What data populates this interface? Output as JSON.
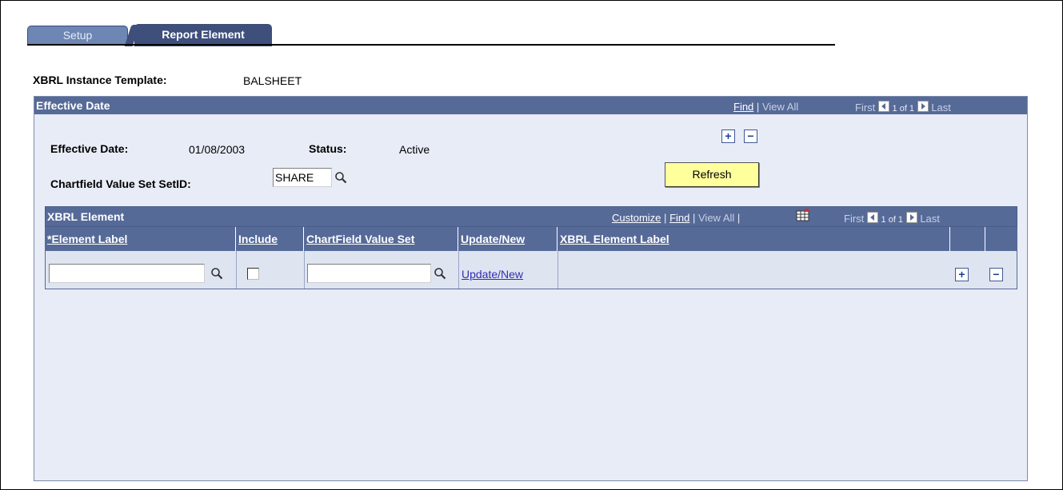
{
  "tabs": [
    {
      "label": "Setup",
      "active": false
    },
    {
      "label": "Report Element",
      "active": true
    }
  ],
  "template": {
    "label": "XBRL Instance Template:",
    "value": "BALSHEET"
  },
  "effective_group": {
    "title": "Effective Date",
    "nav": {
      "find": "Find",
      "sep": "|",
      "view_all": "View All",
      "first": "First",
      "count": "1 of 1",
      "last": "Last"
    },
    "effective_date_label": "Effective Date:",
    "effective_date_value": "01/08/2003",
    "status_label": "Status:",
    "status_value": "Active",
    "setid_label": "Chartfield Value Set SetID:",
    "setid_value": "SHARE",
    "refresh_label": "Refresh"
  },
  "grid": {
    "title": "XBRL Element",
    "nav": {
      "customize": "Customize",
      "sep": "|",
      "find": "Find",
      "view_all": "View All",
      "first": "First",
      "count": "1 of 1",
      "last": "Last"
    },
    "columns": [
      "*Element Label",
      "Include",
      "ChartField Value Set",
      "Update/New",
      "XBRL Element Label"
    ],
    "row": {
      "element_label": "",
      "include": false,
      "chartfield_value_set": "",
      "update_link": "Update/New",
      "xbrl_label": ""
    }
  },
  "colors": {
    "header_bg": "#566a98",
    "group_bg": "#e8ecf6",
    "refresh_bg": "#ffff9c",
    "link": "#2f2fb0"
  }
}
